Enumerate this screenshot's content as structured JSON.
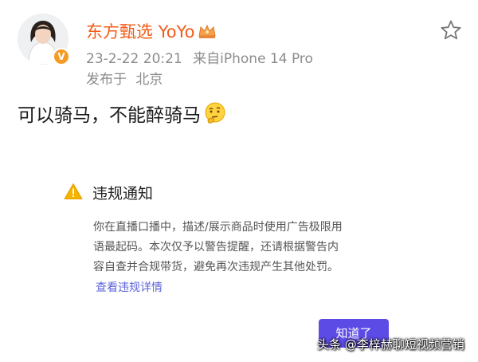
{
  "post": {
    "author": "东方甄选 YoYo",
    "date": "23-2-22 20:21",
    "source": "来自iPhone 14 Pro",
    "location_prefix": "发布于",
    "location": "北京",
    "text": "可以骑马，不能醉骑马",
    "verified_badge": "V"
  },
  "notice": {
    "title": "违规通知",
    "body_lines": [
      "你在直播口播中，描述/展示商品时使用广告极限用",
      "语最起码。本次仅予以警告提醒，还请根据警告内",
      "容自查并合规带货，避免再次违规产生其他处罚。"
    ],
    "link": "查看违规详情",
    "ok_button": "知道了"
  },
  "watermark": "头条 @李梓赫聊短视频营销",
  "colors": {
    "accent_orange": "#f25c19",
    "meta_gray": "#8c8c8c",
    "button_purple": "#5d4be6",
    "link_blue": "#5b63d8",
    "warning_yellow": "#f5b400"
  },
  "icons": {
    "star": "star-outline-icon",
    "warning": "warning-triangle-icon",
    "crown": "crown-icon",
    "emoji": "thinking-face-icon"
  }
}
